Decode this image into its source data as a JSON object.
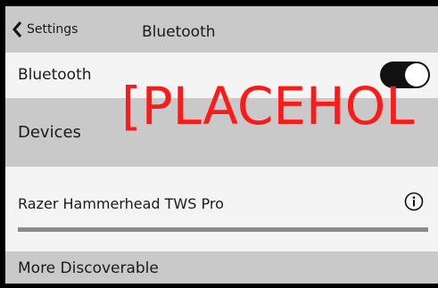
{
  "navbar": {
    "back_label": "Settings",
    "title": "Bluetooth",
    "back_icon": "chevron-left-icon"
  },
  "bluetooth_row": {
    "label": "Bluetooth",
    "toggle_on": true
  },
  "devices_section": {
    "header": "Devices"
  },
  "devices": [
    {
      "name": "Razer Hammerhead TWS Pro",
      "icon": "info-icon"
    }
  ],
  "more_discoverable": {
    "label": "More Discoverable"
  },
  "overlay": {
    "placeholder_text": "[PLACEHOL"
  },
  "colors": {
    "background": "#c9c9c9",
    "row_background": "#f4f4f4",
    "toggle_on": "#111111",
    "placeholder_red": "#ff1a1a"
  }
}
